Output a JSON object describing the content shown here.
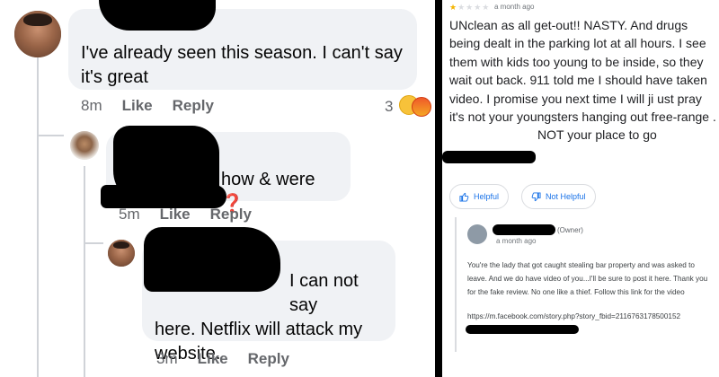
{
  "left_panel": {
    "comments": [
      {
        "text": "I've already seen this season.  I can't say it's great",
        "time": "8m",
        "like": "Like",
        "reply": "Reply",
        "reaction_count": "3"
      },
      {
        "text": "how & were",
        "emoji": "❓",
        "time": "5m",
        "like": "Like",
        "reply": "Reply"
      },
      {
        "text_line1": "I can not say",
        "text_rest": "here. Netflix will attack my website.",
        "time": "3m",
        "like": "Like",
        "reply": "Reply"
      }
    ]
  },
  "right_panel": {
    "time": "a month ago",
    "review_text": "UNclean as all get-out!! NASTY. And drugs being dealt in the parking lot at all hours. I see them with kids too young to be inside, so they wait out back. 911 told me I should have taken video.  I promise you next time I will ji ust pray it's not your youngsters hanging  out free-range .",
    "review_tail": "NOT your place to go",
    "helpful": "Helpful",
    "not_helpful": "Not Helpful",
    "owner_label": "(Owner)",
    "owner_time": "a month ago",
    "owner_response": "You're the lady that got caught stealing bar property and was asked to leave. And we do have video of you...I'll be sure to post it here. Thank you for the fake review. No one like a thief. Follow this link for the video",
    "owner_link": "https://m.facebook.com/story.php?story_fbid=2116763178500152",
    "rating": 1,
    "star_color": "#f4b400"
  }
}
